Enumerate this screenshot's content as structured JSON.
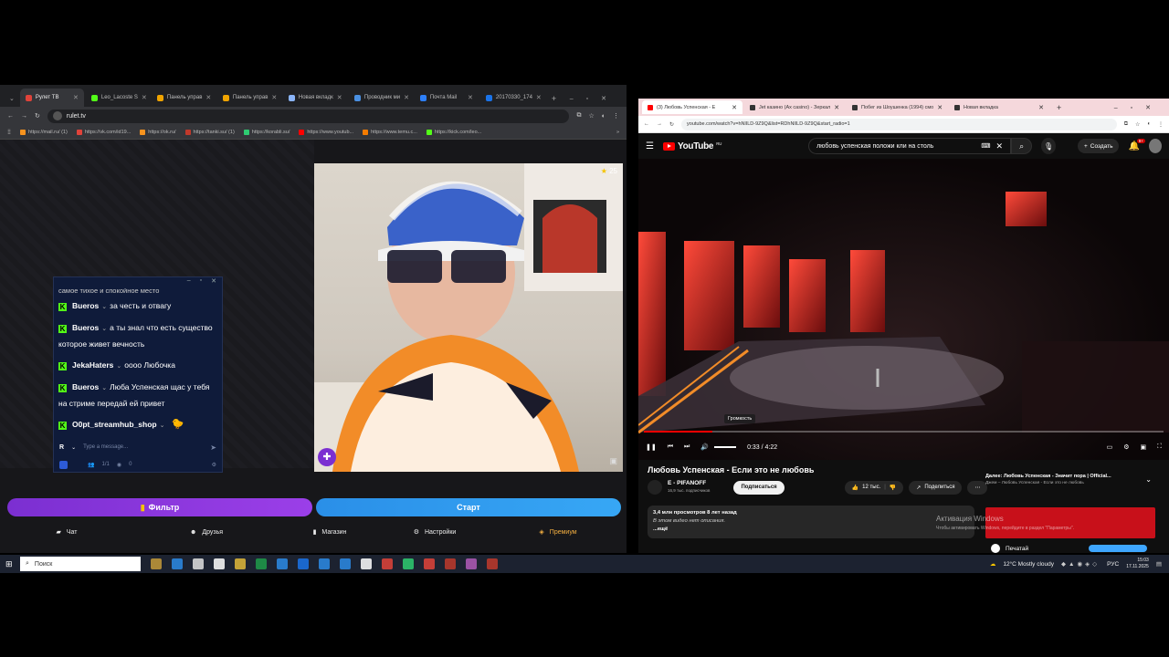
{
  "left_browser": {
    "tabs": [
      {
        "label": "Рулет ТВ",
        "color": "#e0433a",
        "active": true
      },
      {
        "label": "Leo_Lacoste S",
        "color": "#53fc18"
      },
      {
        "label": "Панель управ",
        "color": "#f0a400"
      },
      {
        "label": "Панель управ",
        "color": "#f0a400"
      },
      {
        "label": "Новая вкладк",
        "color": "#8ab4f8"
      },
      {
        "label": "Проводник ми",
        "color": "#4a90e2"
      },
      {
        "label": "Почта Mail",
        "color": "#2d7ff9"
      },
      {
        "label": "20170330_174",
        "color": "#1a73e8"
      }
    ],
    "address": "rulet.tv",
    "bookmarks": [
      {
        "label": "https://mail.ru/ (1)",
        "color": "#f7931e"
      },
      {
        "label": "https://vk.com/id19...",
        "color": "#e0433a"
      },
      {
        "label": "https://ok.ru/",
        "color": "#f7931e"
      },
      {
        "label": "https://tanki.su/ (1)",
        "color": "#c0392b"
      },
      {
        "label": "https://korabli.su/",
        "color": "#2ecc71"
      },
      {
        "label": "https://www.youtub...",
        "color": "#ff0000"
      },
      {
        "label": "https://www.temu.c...",
        "color": "#f57c00"
      },
      {
        "label": "https://kick.com/leo...",
        "color": "#53fc18"
      }
    ]
  },
  "stream": {
    "viewer_count": "25",
    "chat": {
      "partial_top": "самое тихое и спокойное место",
      "messages": [
        {
          "user": "Bueros",
          "text": "за честь и отвагу"
        },
        {
          "user": "Bueros",
          "text": "а ты знал что есть существо которое живет вечность"
        },
        {
          "user": "JekaHaters",
          "text": "оооо Любочка"
        },
        {
          "user": "Bueros",
          "text": "Люба Успенская щас у тебя на стриме передай ей привет"
        },
        {
          "user": "O0pt_streamhub_shop",
          "text": ""
        }
      ],
      "input_placeholder": "Type a message...",
      "input_badge": "R",
      "footer": {
        "count_a": "1/1",
        "count_b": "0"
      }
    },
    "buttons": {
      "filter": "Фильтр",
      "start": "Старт"
    },
    "nav": [
      {
        "label": "Чат",
        "icon": "chat-icon"
      },
      {
        "label": "Друзья",
        "icon": "friends-icon"
      },
      {
        "label": "Магазин",
        "icon": "shop-icon"
      },
      {
        "label": "Настройки",
        "icon": "settings-icon"
      },
      {
        "label": "Премиум",
        "icon": "premium-icon",
        "color": "#f5b041"
      }
    ]
  },
  "right_browser": {
    "tabs": [
      {
        "label": "(3) Любовь Успенская - Е",
        "color": "#ff0000",
        "active": true
      },
      {
        "label": "Jet казино (Ax casino) - Зеркал",
        "color": "#333333"
      },
      {
        "label": "Побег из Шоушенка (1994) смо",
        "color": "#333333"
      },
      {
        "label": "Новая вкладка",
        "color": "#333333"
      }
    ],
    "address": "youtube.com/watch?v=hNlILD-9Z9Q&list=RDhNlILD-9Z9Q&start_radio=1",
    "youtube": {
      "logo_text": "YouTube",
      "region": "RU",
      "search_query": "любовь успенская положи кли на столь",
      "create_label": "Создать",
      "notifications": "9+",
      "video": {
        "progress": 0.1318,
        "time": "0:33 / 4:22",
        "tooltip": "Громкость"
      },
      "title": "Любовь Успенская - Если это не любовь",
      "channel": "E - PIFANOFF",
      "subscribers": "16,9 тыс. подписчиков",
      "subscribe_label": "Подписаться",
      "likes": "12 тыс.",
      "share_label": "Поделиться",
      "description": {
        "stats": "3,4 млн просмотров  8 лет назад",
        "text": "В этом видео нет описания.",
        "more": "...ещё"
      },
      "up_next": {
        "title": "Далее: Любовь Успенская - Значит пора | Official...",
        "subtitle": "Джем – Любовь Успенская - Если это не любовь"
      },
      "activation": {
        "title": "Активация Windows",
        "text": "Чтобы активировать Windows, перейдите в раздел \"Параметры\"."
      },
      "print_label": "Печатай"
    }
  },
  "taskbar": {
    "search_placeholder": "Поиск",
    "weather": "12°C  Mostly cloudy",
    "language": "РУС",
    "time": "15:03",
    "date": "17.11.2025"
  }
}
